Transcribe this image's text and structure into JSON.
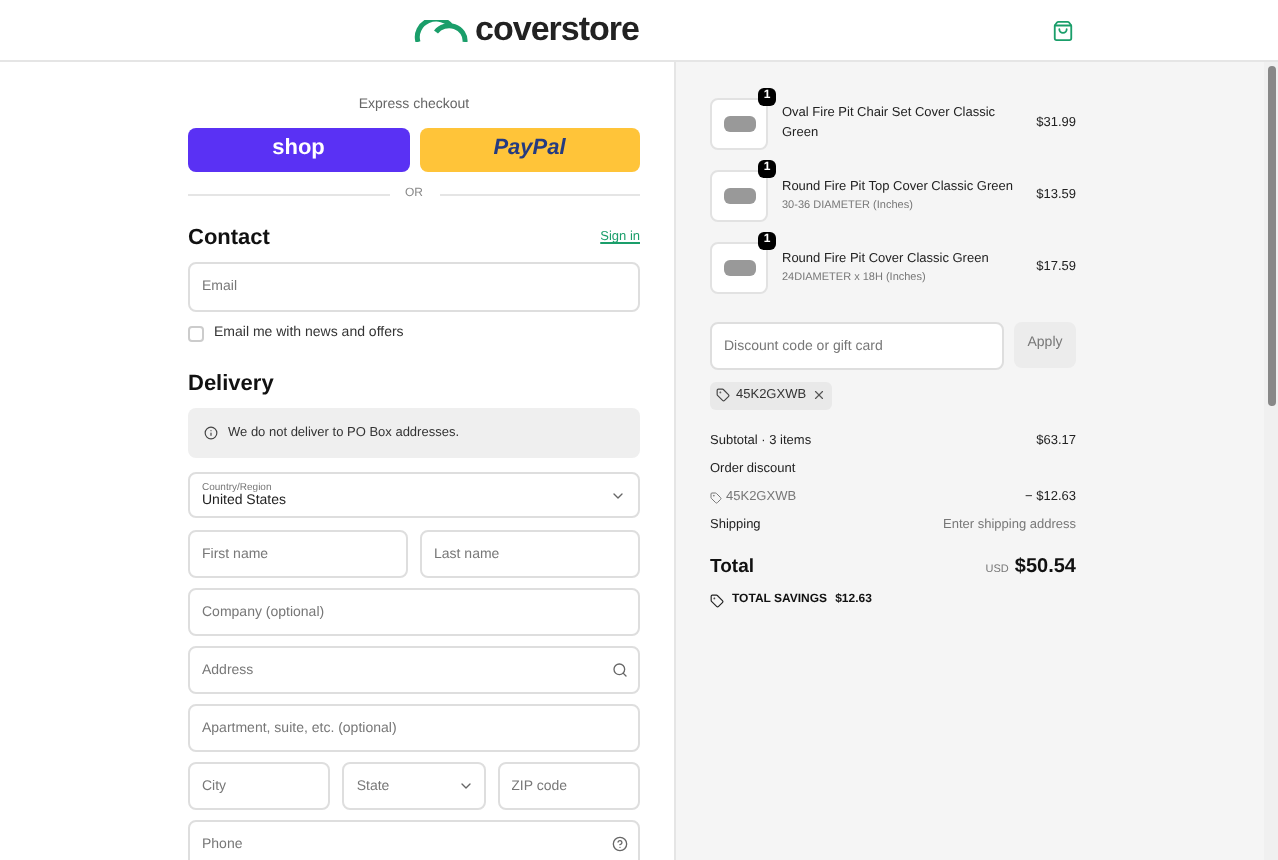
{
  "header": {
    "logo": "coverstore"
  },
  "express": {
    "label": "Express checkout",
    "buttons": [
      {
        "kind": "shop",
        "label": "shop"
      },
      {
        "kind": "paypal",
        "label": "PayPal"
      }
    ],
    "divider": "OR"
  },
  "contact": {
    "title": "Contact",
    "link": "Sign in",
    "email": {
      "placeholder": "Email"
    },
    "newsletter": {
      "label": "Email me with news and offers",
      "checked": false
    }
  },
  "delivery": {
    "title": "Delivery",
    "notice": "We do not deliver to PO Box addresses.",
    "country": {
      "label": "Country/Region",
      "value": "United States"
    },
    "rows": [
      [
        {
          "kind": "text",
          "placeholder": "First name"
        },
        {
          "kind": "text",
          "placeholder": "Last name"
        }
      ],
      [
        {
          "kind": "text",
          "placeholder": "Company (optional)"
        }
      ],
      [
        {
          "kind": "search",
          "placeholder": "Address"
        }
      ],
      [
        {
          "kind": "text",
          "placeholder": "Apartment, suite, etc. (optional)"
        }
      ],
      [
        {
          "kind": "text",
          "placeholder": "City"
        },
        {
          "kind": "select",
          "placeholder": "State"
        },
        {
          "kind": "text",
          "placeholder": "ZIP code"
        }
      ],
      [
        {
          "kind": "help",
          "placeholder": "Phone"
        }
      ]
    ]
  },
  "cart": {
    "items": [
      {
        "quantity": "1",
        "name": "Oval Fire Pit Chair Set Cover Classic Green",
        "price": "$31.99"
      },
      {
        "quantity": "1",
        "name": "Round Fire Pit Top Cover Classic Green",
        "variant": "30-36 DIAMETER (Inches)",
        "price": "$13.59"
      },
      {
        "quantity": "1",
        "name": "Round Fire Pit Cover Classic Green",
        "variant": "24DIAMETER x 18H (Inches)",
        "price": "$17.59"
      }
    ],
    "discount": {
      "placeholder": "Discount code or gift card",
      "button": "Apply",
      "applied_code": "45K2GXWB"
    },
    "summary": {
      "subtotal_label": "Subtotal · 3 items",
      "subtotal": "$63.17",
      "order_discount_label": "Order discount",
      "discount_code": "45K2GXWB",
      "discount_amount": "− $12.63",
      "shipping_label": "Shipping",
      "shipping_value": "Enter shipping address",
      "total_label": "Total",
      "currency": "USD",
      "total": "$50.54",
      "savings_label": "TOTAL SAVINGS",
      "savings": "$12.63"
    }
  }
}
